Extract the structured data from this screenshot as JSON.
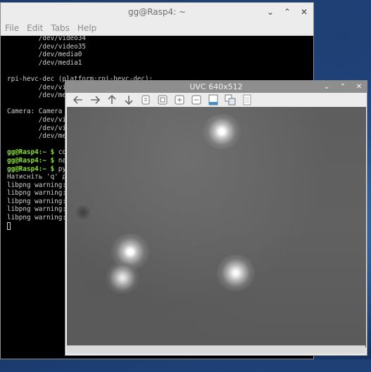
{
  "terminal": {
    "title": "gg@Rasp4: ~",
    "menu": [
      "File",
      "Edit",
      "Tabs",
      "Help"
    ],
    "lines": [
      "        /dev/video34",
      "        /dev/video35",
      "        /dev/media0",
      "        /dev/media1",
      "",
      "rpi-hevc-dec (platform:rpi-hevc-dec):",
      "        /dev/vid",
      "        /dev/med",
      "",
      "Camera: Camera (",
      "        /dev/vid",
      "        /dev/vid",
      "        /dev/med",
      "",
      "gg@Rasp4:~ $ cd",
      "gg@Rasp4:~ $ nan",
      "gg@Rasp4:~ $ pyt",
      "Натисніть 'q' дл",
      "libpng warning:",
      "libpng warning:",
      "libpng warning:",
      "libpng warning:",
      "libpng warning:"
    ],
    "prompt": "gg@Rasp4:~ $"
  },
  "uvc": {
    "title": "UVC 640x512",
    "toolbar_icons": [
      "arrow-left-icon",
      "arrow-right-icon",
      "arrow-up-icon",
      "arrow-down-icon",
      "copy-icon",
      "zoom-fit-icon",
      "zoom-in-icon",
      "zoom-out-icon",
      "save-icon",
      "settings-icon",
      "document-icon"
    ]
  },
  "colors": {
    "desktop": "#1f4478",
    "terminal_bg": "#000000",
    "prompt": "#8ae234"
  }
}
